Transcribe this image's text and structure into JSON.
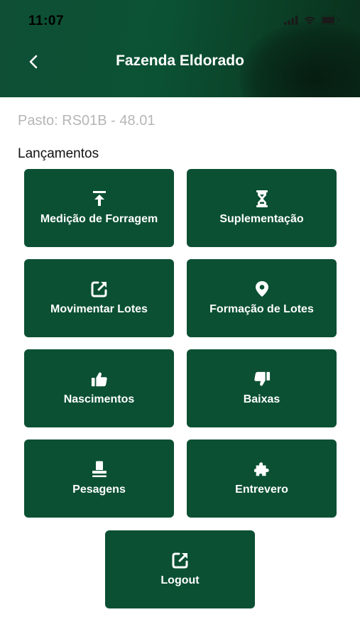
{
  "status_bar": {
    "time": "11:07",
    "icons": [
      "signal-icon",
      "wifi-icon",
      "battery-icon"
    ]
  },
  "header": {
    "title": "Fazenda Eldorado",
    "back_icon": "chevron-left-icon"
  },
  "pasto": "Pasto: RS01B - 48.01",
  "section_title": "Lançamentos",
  "tiles": [
    {
      "label": "Medição de Forragem",
      "icon": "upload-icon"
    },
    {
      "label": "Suplementação",
      "icon": "hourglass-icon"
    },
    {
      "label": "Movimentar Lotes",
      "icon": "external-link-icon"
    },
    {
      "label": "Formação de Lotes",
      "icon": "map-pin-icon"
    },
    {
      "label": "Nascimentos",
      "icon": "thumbs-up-icon"
    },
    {
      "label": "Baixas",
      "icon": "thumbs-down-icon"
    },
    {
      "label": "Pesagens",
      "icon": "stamp-icon"
    },
    {
      "label": "Entrevero",
      "icon": "puzzle-icon"
    }
  ],
  "logout": {
    "label": "Logout",
    "icon": "external-link-icon"
  },
  "colors": {
    "primary": "#0b5033",
    "header": "#0b5234",
    "muted_text": "#b6b6b6"
  }
}
